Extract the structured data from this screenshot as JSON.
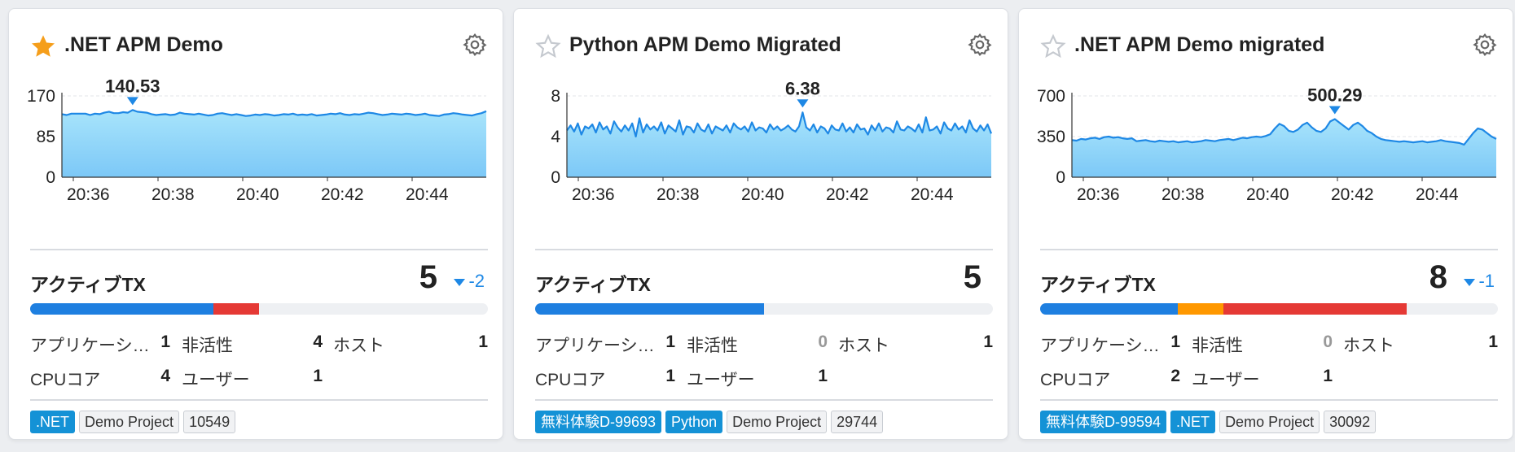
{
  "cards": [
    {
      "title": ".NET APM Demo",
      "starred": true,
      "star_icon": "star-filled-icon",
      "star_color": "#f59e1b",
      "chart_data": {
        "type": "area",
        "y_ticks": [
          "170",
          "85",
          "0"
        ],
        "ylim": [
          0,
          170
        ],
        "x_ticks": [
          "20:36",
          "20:38",
          "20:40",
          "20:42",
          "20:44"
        ],
        "peak_label": "140.53",
        "peak_index": 15,
        "values": [
          132,
          130,
          133,
          133,
          133,
          133,
          130,
          133,
          132,
          135,
          137,
          134,
          134,
          136,
          135,
          140.53,
          137,
          136,
          135,
          132,
          130,
          131,
          132,
          130,
          131,
          135,
          133,
          132,
          131,
          133,
          131,
          129,
          130,
          133,
          134,
          132,
          130,
          132,
          130,
          128,
          129,
          131,
          130,
          132,
          131,
          129,
          130,
          132,
          131,
          133,
          130,
          131,
          130,
          132,
          129,
          130,
          131,
          133,
          132,
          134,
          131,
          130,
          132,
          131,
          133,
          135,
          134,
          132,
          130,
          131,
          133,
          132,
          131,
          133,
          132,
          130,
          131,
          133,
          130,
          129,
          128,
          131,
          132,
          134,
          133,
          131,
          130,
          129,
          132,
          134,
          138
        ],
        "line_color": "#1e88e5",
        "fill_color": "#7dd3f5"
      },
      "tx_label": "アクティブTX",
      "tx_count": "5",
      "tx_delta": "-2",
      "tx_bar": [
        {
          "fraction": 0.4,
          "color": "#1e7fe0"
        },
        {
          "fraction": 0.1,
          "color": "#e53935"
        }
      ],
      "stats": {
        "app_label": "アプリケーシ…",
        "app_value": "1",
        "inactive_label": "非活性",
        "inactive_value": "4",
        "host_label": "ホスト",
        "host_value": "1",
        "cpu_label": "CPUコア",
        "cpu_value": "4",
        "user_label": "ユーザー",
        "user_value": "1"
      },
      "tags": [
        {
          "text": ".NET",
          "style": "blue"
        },
        {
          "text": "Demo Project",
          "style": "grey"
        },
        {
          "text": "10549",
          "style": "grey"
        }
      ]
    },
    {
      "title": "Python APM Demo Migrated",
      "starred": false,
      "star_icon": "star-outline-icon",
      "star_color": "#c5c9cf",
      "chart_data": {
        "type": "area",
        "y_ticks": [
          "8",
          "4",
          "0"
        ],
        "ylim": [
          0,
          8
        ],
        "x_ticks": [
          "20:36",
          "20:38",
          "20:40",
          "20:42",
          "20:44"
        ],
        "peak_label": "6.38",
        "peak_index": 65,
        "values": [
          4.6,
          5.1,
          4.5,
          5.3,
          4.2,
          5.0,
          4.8,
          5.2,
          4.4,
          5.4,
          4.7,
          5.0,
          4.3,
          5.5,
          4.9,
          4.5,
          5.1,
          4.6,
          5.3,
          4.0,
          5.8,
          4.4,
          5.2,
          4.7,
          5.0,
          4.6,
          5.4,
          4.3,
          5.1,
          4.8,
          4.5,
          5.6,
          4.2,
          5.0,
          4.9,
          4.4,
          5.3,
          4.7,
          4.5,
          5.2,
          4.3,
          5.0,
          4.8,
          4.6,
          5.1,
          4.4,
          5.3,
          4.9,
          4.7,
          5.0,
          4.5,
          5.4,
          4.6,
          4.9,
          4.8,
          4.4,
          5.2,
          4.7,
          5.0,
          4.6,
          4.8,
          5.1,
          4.7,
          4.5,
          5.0,
          6.38,
          4.9,
          4.6,
          5.2,
          4.4,
          5.0,
          4.8,
          4.3,
          5.1,
          4.7,
          4.6,
          5.3,
          4.5,
          4.9,
          4.4,
          5.2,
          4.7,
          4.8,
          4.2,
          5.1,
          4.6,
          5.3,
          4.5,
          4.9,
          4.8,
          4.4,
          5.5,
          4.7,
          4.6,
          5.0,
          4.8,
          4.5,
          5.2,
          4.4,
          5.9,
          4.6,
          4.7,
          5.0,
          4.3,
          5.4,
          4.8,
          4.6,
          5.3,
          4.7,
          5.0,
          4.4,
          5.6,
          4.8,
          4.5,
          5.1,
          4.6,
          5.2,
          4.3
        ]
      },
      "tx_label": "アクティブTX",
      "tx_count": "5",
      "tx_delta": "",
      "tx_bar": [
        {
          "fraction": 0.5,
          "color": "#1e7fe0"
        }
      ],
      "stats": {
        "app_label": "アプリケーシ…",
        "app_value": "1",
        "inactive_label": "非活性",
        "inactive_value": "0",
        "host_label": "ホスト",
        "host_value": "1",
        "cpu_label": "CPUコア",
        "cpu_value": "1",
        "user_label": "ユーザー",
        "user_value": "1"
      },
      "tags": [
        {
          "text": "無料体験D-99693",
          "style": "blue"
        },
        {
          "text": "Python",
          "style": "blue"
        },
        {
          "text": "Demo Project",
          "style": "grey"
        },
        {
          "text": "29744",
          "style": "grey"
        }
      ]
    },
    {
      "title": ".NET APM Demo migrated",
      "starred": false,
      "star_icon": "star-outline-icon",
      "star_color": "#c5c9cf",
      "chart_data": {
        "type": "area",
        "y_ticks": [
          "700",
          "350",
          "0"
        ],
        "ylim": [
          0,
          700
        ],
        "x_ticks": [
          "20:36",
          "20:38",
          "20:40",
          "20:42",
          "20:44"
        ],
        "peak_label": "500.29",
        "peak_index": 57,
        "values": [
          320,
          315,
          330,
          325,
          335,
          340,
          330,
          345,
          350,
          340,
          345,
          335,
          330,
          335,
          310,
          315,
          320,
          310,
          305,
          315,
          310,
          305,
          310,
          300,
          305,
          310,
          300,
          305,
          310,
          320,
          315,
          310,
          320,
          325,
          330,
          320,
          330,
          340,
          335,
          345,
          350,
          345,
          355,
          370,
          420,
          460,
          440,
          400,
          390,
          410,
          450,
          470,
          430,
          400,
          390,
          420,
          480,
          500.29,
          470,
          440,
          410,
          450,
          470,
          440,
          400,
          380,
          350,
          330,
          320,
          315,
          310,
          305,
          310,
          305,
          300,
          305,
          310,
          300,
          305,
          310,
          320,
          310,
          305,
          300,
          295,
          280,
          330,
          380,
          420,
          410,
          380,
          350,
          330
        ]
      },
      "tx_label": "アクティブTX",
      "tx_count": "8",
      "tx_delta": "-1",
      "tx_bar": [
        {
          "fraction": 0.3,
          "color": "#1e7fe0"
        },
        {
          "fraction": 0.1,
          "color": "#ff9800"
        },
        {
          "fraction": 0.4,
          "color": "#e53935"
        }
      ],
      "stats": {
        "app_label": "アプリケーシ…",
        "app_value": "1",
        "inactive_label": "非活性",
        "inactive_value": "0",
        "host_label": "ホスト",
        "host_value": "1",
        "cpu_label": "CPUコア",
        "cpu_value": "2",
        "user_label": "ユーザー",
        "user_value": "1"
      },
      "tags": [
        {
          "text": "無料体験D-99594",
          "style": "blue"
        },
        {
          "text": ".NET",
          "style": "blue"
        },
        {
          "text": "Demo Project",
          "style": "grey"
        },
        {
          "text": "30092",
          "style": "grey"
        }
      ]
    }
  ],
  "colors": {
    "line": "#1e88e5",
    "area_top": "#a8e4fb",
    "area_bottom": "#7cc8f7",
    "grid": "#e3e6ea",
    "axis_text": "#222",
    "delta": "#1e88e5"
  },
  "icons": {
    "gear": "gear-icon",
    "peak_marker": "triangle-down-icon",
    "delta": "triangle-down-icon"
  }
}
